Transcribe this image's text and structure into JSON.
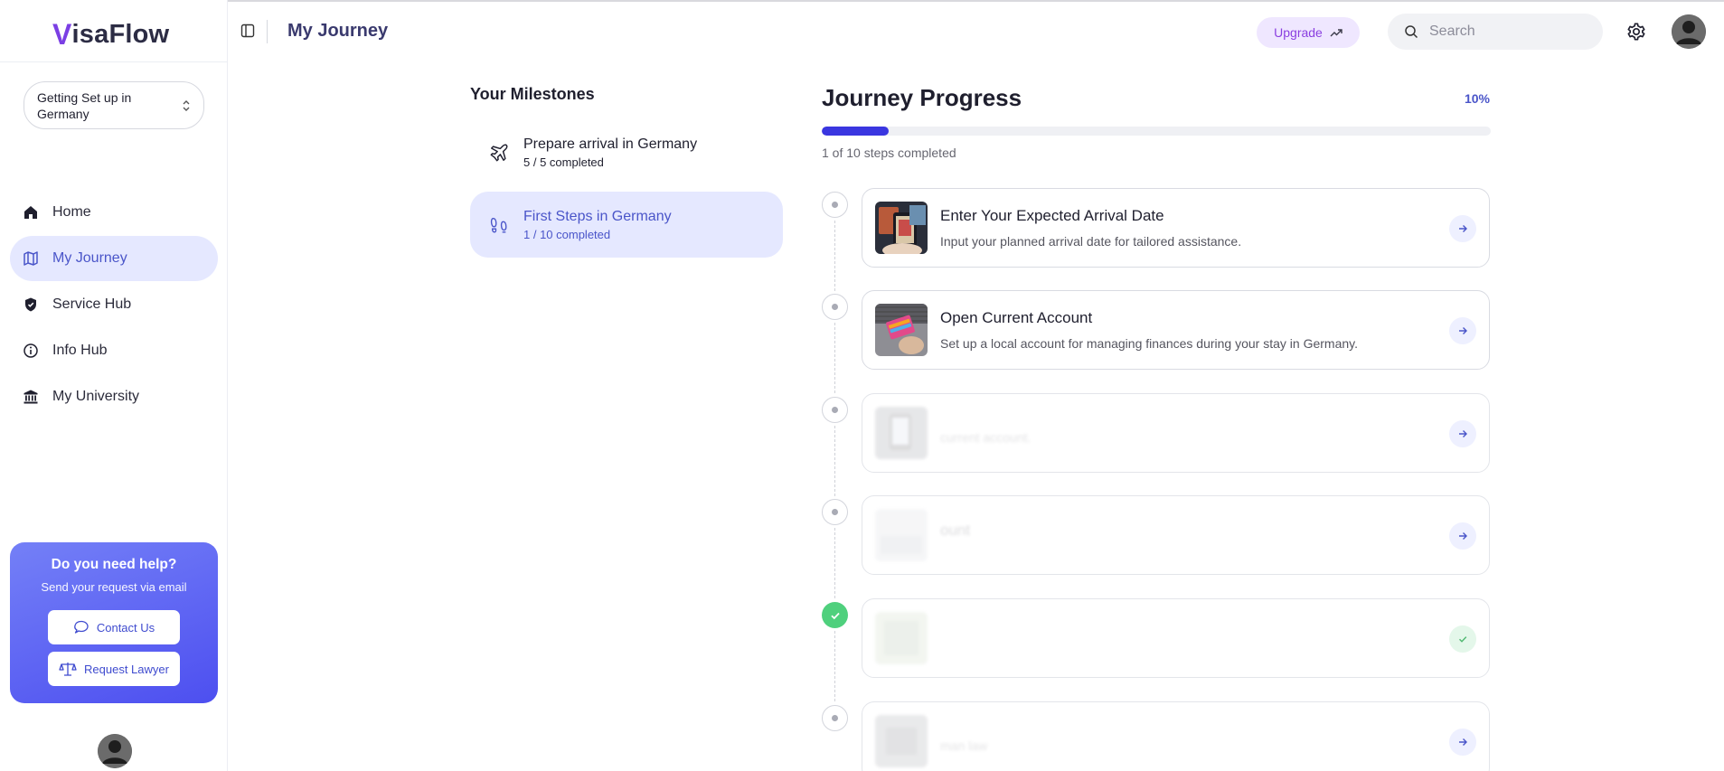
{
  "app": {
    "logo_v": "V",
    "logo_rest": "isaFlow"
  },
  "header": {
    "title": "My Journey",
    "upgrade_label": "Upgrade",
    "search_placeholder": "Search"
  },
  "sidebar": {
    "workspace_label": "Getting Set up in Germany",
    "items": [
      {
        "label": "Home",
        "icon": "home-icon",
        "active": false
      },
      {
        "label": "My Journey",
        "icon": "map-icon",
        "active": true
      },
      {
        "label": "Service Hub",
        "icon": "shield-icon",
        "active": false
      },
      {
        "label": "Info Hub",
        "icon": "info-icon",
        "active": false
      },
      {
        "label": "My University",
        "icon": "university-icon",
        "active": false
      }
    ],
    "help": {
      "title": "Do you need help?",
      "subtitle": "Send your request via email",
      "contact_label": "Contact Us",
      "lawyer_label": "Request Lawyer"
    }
  },
  "milestones": {
    "title": "Your Milestones",
    "items": [
      {
        "name": "Prepare arrival in Germany",
        "count": "5 / 5 completed",
        "icon": "plane-icon",
        "active": false
      },
      {
        "name": "First Steps in Germany",
        "count": "1 / 10 completed",
        "icon": "footprints-icon",
        "active": true
      }
    ]
  },
  "progress": {
    "title": "Journey Progress",
    "percent_label": "10%",
    "fraction": 0.1,
    "steps_label": "1 of 10 steps completed"
  },
  "steps": [
    {
      "title": "Enter Your Expected Arrival Date",
      "desc": "Input your planned arrival date for tailored assistance.",
      "status": "pending"
    },
    {
      "title": "Open Current Account",
      "desc": "Set up a local account for managing finances during your stay in Germany.",
      "status": "pending"
    },
    {
      "title": "",
      "desc": "current account.",
      "status": "locked"
    },
    {
      "title": "ount",
      "desc": "",
      "status": "locked"
    },
    {
      "title": "",
      "desc": "",
      "status": "done"
    },
    {
      "title": "",
      "desc": "man law",
      "status": "locked"
    }
  ],
  "colors": {
    "accent": "#4a55c9",
    "progress_fill": "#3a36e0",
    "active_bg": "#e5e8ff",
    "upgrade_text": "#8a3fe0",
    "done_green": "#4fd07d"
  }
}
